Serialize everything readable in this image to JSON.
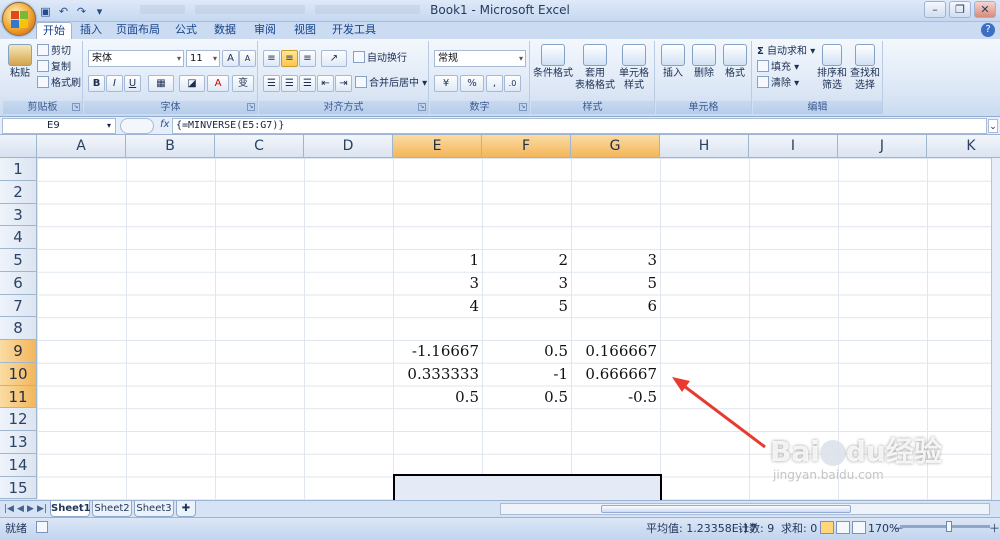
{
  "window": {
    "title": "Book1 - Microsoft Excel",
    "minimize": "–",
    "restore": "❐",
    "close": "✕"
  },
  "quick_access": {
    "save_icon": "save-icon",
    "undo_icon": "undo-icon",
    "redo_icon": "redo-icon",
    "customize_icon": "chevron-down-icon"
  },
  "tabs": [
    {
      "label": "开始",
      "active": true
    },
    {
      "label": "插入"
    },
    {
      "label": "页面布局"
    },
    {
      "label": "公式"
    },
    {
      "label": "数据"
    },
    {
      "label": "审阅"
    },
    {
      "label": "视图"
    },
    {
      "label": "开发工具"
    }
  ],
  "ribbon": {
    "clipboard": {
      "label": "剪贴板",
      "paste": "粘贴",
      "cut": "剪切",
      "copy": "复制",
      "format_painter": "格式刷"
    },
    "font": {
      "label": "字体",
      "name": "宋体",
      "size": "11",
      "bold": "B",
      "italic": "I",
      "underline": "U",
      "grow": "A",
      "shrink": "A",
      "font_color": "A",
      "wen": "变"
    },
    "alignment": {
      "label": "对齐方式",
      "wrap": "自动换行",
      "merge": "合并后居中"
    },
    "number": {
      "label": "数字",
      "format": "常规",
      "percent": "%",
      "comma": ","
    },
    "styles": {
      "label": "样式",
      "conditional": "条件格式",
      "table_line1": "套用",
      "table_line2": "表格格式",
      "cell_line1": "单元格",
      "cell_line2": "样式"
    },
    "cells": {
      "label": "单元格",
      "insert": "插入",
      "delete": "删除",
      "format": "格式"
    },
    "editing": {
      "label": "编辑",
      "sigma": "Σ",
      "autosum": "自动求和",
      "fill": "填充",
      "clear": "清除",
      "sort_line1": "排序和",
      "sort_line2": "筛选",
      "find_line1": "查找和",
      "find_line2": "选择"
    }
  },
  "formula_bar": {
    "name_box": "E9",
    "fx": "fx",
    "formula": "{=MINVERSE(E5:G7)}"
  },
  "grid": {
    "columns": [
      "A",
      "B",
      "C",
      "D",
      "E",
      "F",
      "G",
      "H",
      "I",
      "J",
      "K"
    ],
    "selected_columns": [
      "E",
      "F",
      "G"
    ],
    "rows": [
      "1",
      "2",
      "3",
      "4",
      "5",
      "6",
      "7",
      "8",
      "9",
      "10",
      "11",
      "12",
      "13",
      "14",
      "15"
    ],
    "selected_rows": [
      "9",
      "10",
      "11"
    ],
    "values": [
      {
        "ref": "E5",
        "text": "1"
      },
      {
        "ref": "F5",
        "text": "2"
      },
      {
        "ref": "G5",
        "text": "3"
      },
      {
        "ref": "E6",
        "text": "3"
      },
      {
        "ref": "F6",
        "text": "3"
      },
      {
        "ref": "G6",
        "text": "5"
      },
      {
        "ref": "E7",
        "text": "4"
      },
      {
        "ref": "F7",
        "text": "5"
      },
      {
        "ref": "G7",
        "text": "6"
      },
      {
        "ref": "E9",
        "text": "-1.16667"
      },
      {
        "ref": "F9",
        "text": "0.5"
      },
      {
        "ref": "G9",
        "text": "0.166667"
      },
      {
        "ref": "E10",
        "text": "0.333333"
      },
      {
        "ref": "F10",
        "text": "-1"
      },
      {
        "ref": "G10",
        "text": "0.666667"
      },
      {
        "ref": "E11",
        "text": "0.5"
      },
      {
        "ref": "F11",
        "text": "0.5"
      },
      {
        "ref": "G11",
        "text": "-0.5"
      }
    ],
    "annotation_arrow_color": "#e63b2e"
  },
  "sheets": [
    {
      "label": "Sheet1",
      "active": true
    },
    {
      "label": "Sheet2"
    },
    {
      "label": "Sheet3"
    }
  ],
  "status": {
    "ready": "就绪",
    "average": "平均值: 1.23358E-17",
    "count": "计数: 9",
    "sum": "求和: 0",
    "zoom": "170%",
    "zoom_out": "－",
    "zoom_in": "＋"
  },
  "watermark": {
    "brand": "Bai",
    "brand2": "du",
    "suffix": "经验",
    "url": "jingyan.baidu.com"
  }
}
